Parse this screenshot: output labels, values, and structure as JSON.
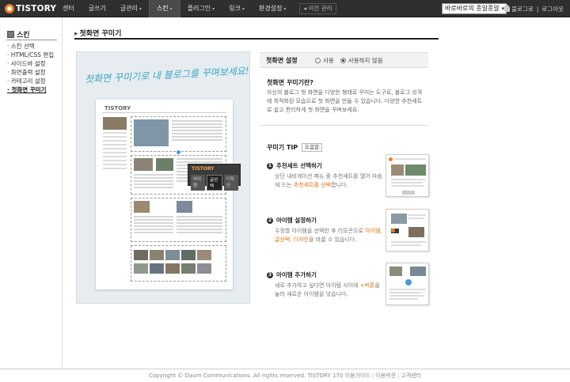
{
  "topbar": {
    "logo": "TISTORY",
    "nav": [
      {
        "label": "센터",
        "arrow": false,
        "active": false
      },
      {
        "label": "글쓰기",
        "arrow": false,
        "active": false
      },
      {
        "label": "글관리",
        "arrow": true,
        "active": false
      },
      {
        "label": "스킨",
        "arrow": true,
        "active": true
      },
      {
        "label": "플러그인",
        "arrow": true,
        "active": false
      },
      {
        "label": "링크",
        "arrow": true,
        "active": false
      },
      {
        "label": "환경설정",
        "arrow": true,
        "active": false
      }
    ],
    "old_admin": "◂ 이전 관리",
    "blog_select_value": "바로바로의 종알종알",
    "blog_link": "블로그로",
    "logout": "로그아웃"
  },
  "sidebar": {
    "title": "스킨",
    "items": [
      {
        "label": "스킨 선택",
        "active": false
      },
      {
        "label": "HTML/CSS 편집",
        "active": false
      },
      {
        "label": "사이드바 설정",
        "active": false
      },
      {
        "label": "화면출력 설정",
        "active": false
      },
      {
        "label": "카테고리 설정",
        "active": false
      },
      {
        "label": "첫화면 꾸미기",
        "active": true
      }
    ]
  },
  "main": {
    "heading": "첫화면 꾸미기",
    "preview": {
      "handwritten": "첫화면 꾸미기로 내 블로그를 꾸며보세요!",
      "mini_logo": "TISTORY",
      "popup_title": "TISTORY",
      "popup_tabs": [
        "아이템",
        "글선택",
        "디자인"
      ]
    },
    "setting": {
      "label": "첫화면 설정",
      "option_on": "사용",
      "option_off": "사용하지 않음",
      "selected": "off"
    },
    "question": {
      "title": "첫화면 꾸미기란?",
      "desc": "자신의 블로그 첫 화면을 다양한 형태로 꾸미는 도구로, 블로그 성격에 최적화된 모습으로 첫 화면을 만들 수 있습니다. 다양한 추천세트로 쉽고 편리하게 첫 화면을 꾸며보세요."
    },
    "tip": {
      "title": "꾸미기 TIP",
      "help": "도움말",
      "steps": [
        {
          "num": "1",
          "title": "추천세트 선택하기",
          "desc_a": "상단 내비게이션 메뉴 중 추천세트를 열어 마음에 드는 ",
          "desc_hl": "추천세트를 선택",
          "desc_b": "합니다."
        },
        {
          "num": "2",
          "title": "아이템 설정하기",
          "desc_a": "수정할 아이템을 선택한 후 리모콘으로 ",
          "desc_hl": "아이템, 글선택, 디자인",
          "desc_b": "을 바꿀 수 있습니다."
        },
        {
          "num": "3",
          "title": "아이템 추가하기",
          "desc_a": "새로 추가하고 싶다면 아이템 사이에 ",
          "desc_hl": "+버튼",
          "desc_b": "을 눌러 새로운 아이템을 넣습니다."
        }
      ]
    }
  },
  "footer": {
    "copyright": "Copyright © Daum Communications. All rights reserved.",
    "version": "TISTORY 170",
    "links": [
      "이용가이드",
      "이용약관",
      "고객센터"
    ]
  },
  "colors": {
    "accent": "#f27b21",
    "topbar": "#2f2f2f",
    "highlight": "#e0700f",
    "handwriting": "#3aa7c9"
  }
}
